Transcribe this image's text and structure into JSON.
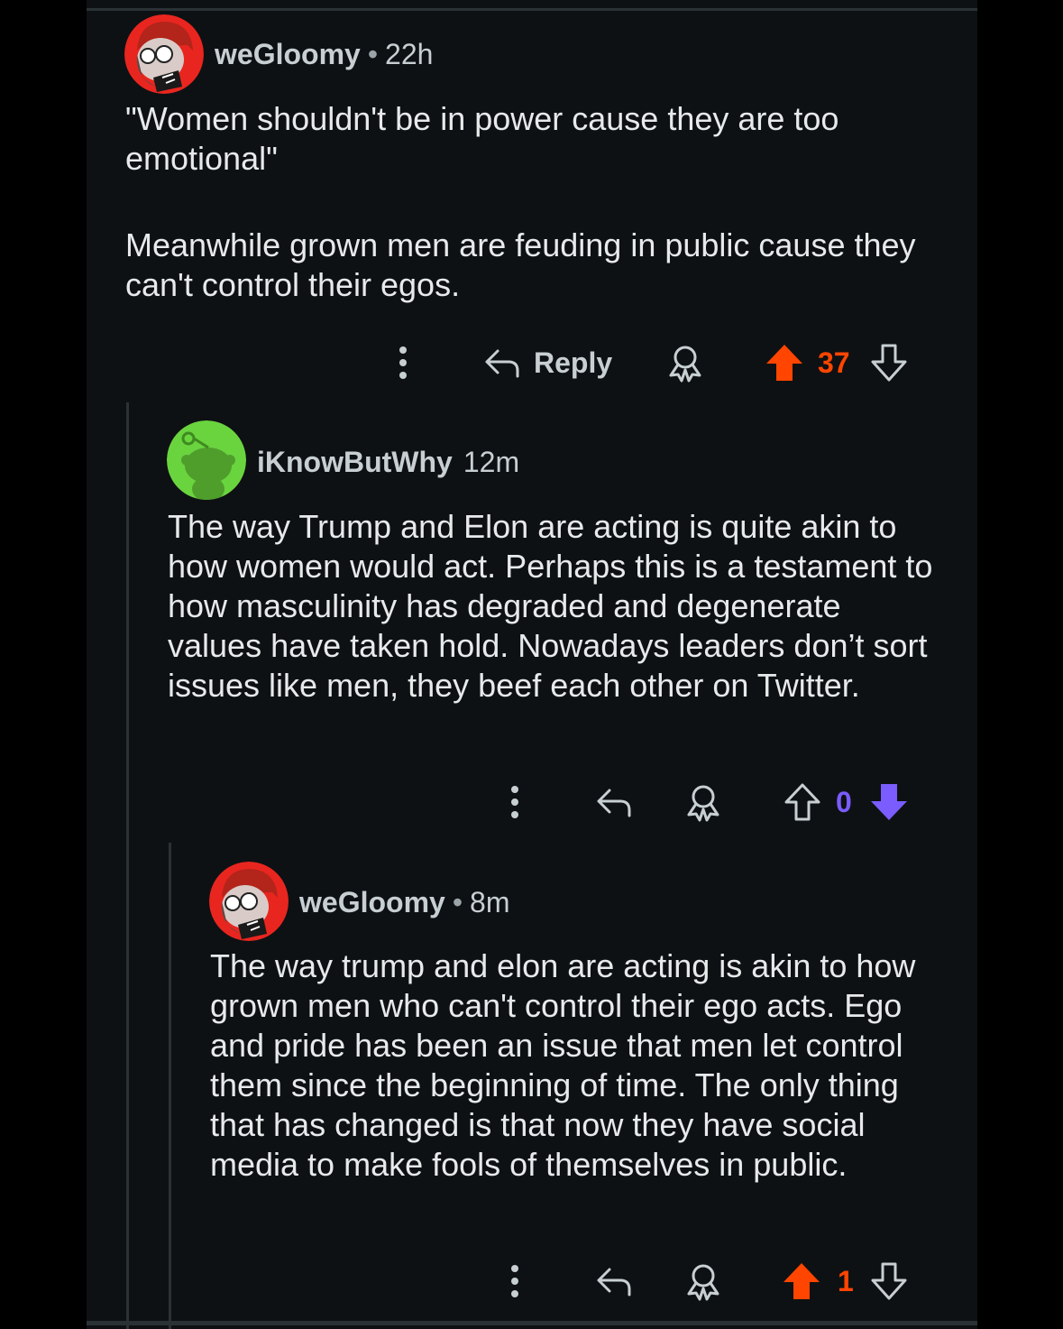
{
  "comments": [
    {
      "username": "weGloomy",
      "separator": "•",
      "time": "22h",
      "paragraphs": [
        "\"Women shouldn't be in power cause they are too emotional\"",
        "Meanwhile grown men are feuding in public cause they can't control their egos."
      ],
      "reply_label": "Reply",
      "score": "37",
      "vote_state": "upvoted",
      "icons": [
        "more-icon",
        "reply-arrow-icon",
        "award-icon",
        "upvote-icon",
        "downvote-icon"
      ]
    },
    {
      "username": "iKnowButWhy",
      "time": "12m",
      "paragraphs": [
        "The way Trump and Elon are acting is quite akin to how women would act. Perhaps this is a testament to how masculinity has degraded and degenerate values have taken hold. Nowadays leaders don’t sort issues like men, they beef each other on Twitter."
      ],
      "score": "0",
      "vote_state": "downvoted",
      "icons": [
        "more-icon",
        "reply-arrow-icon",
        "award-icon",
        "upvote-icon",
        "downvote-icon"
      ]
    },
    {
      "username": "weGloomy",
      "separator": "•",
      "time": "8m",
      "paragraphs": [
        "The way trump and elon are acting is akin to how grown men who can't control their ego acts. Ego and pride has been an issue that men let control them since the beginning of time. The only thing that has changed is that now they have social media to make fools of themselves in public."
      ],
      "score": "1",
      "vote_state": "upvoted",
      "icons": [
        "more-icon",
        "reply-arrow-icon",
        "award-icon",
        "upvote-icon",
        "downvote-icon"
      ]
    }
  ],
  "colors": {
    "background": "#0e1113",
    "text": "#e7e9ea",
    "meta": "#c7cfd3",
    "upvote": "#ff4500",
    "downvote": "#7a5cff",
    "thread_line": "#2a3236",
    "avatar_green": "#6ad43f"
  }
}
